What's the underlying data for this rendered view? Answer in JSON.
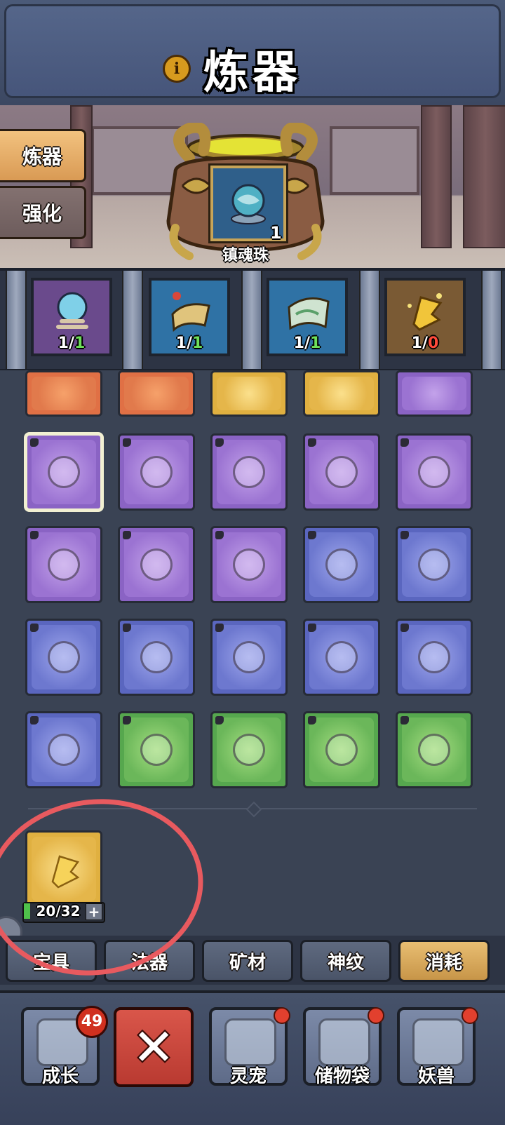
{
  "header": {
    "title": "炼器",
    "info_icon": "info-icon"
  },
  "side_tabs": [
    {
      "label": "炼器",
      "active": true
    },
    {
      "label": "强化",
      "active": false
    }
  ],
  "result": {
    "name": "镇魂珠",
    "count": "1",
    "icon": "soul-orb-icon"
  },
  "materials": [
    {
      "icon": "crystal-orb-icon",
      "have": "1/",
      "need": "1",
      "enough": true
    },
    {
      "icon": "scroll-icon",
      "have": "1/",
      "need": "1",
      "enough": true
    },
    {
      "icon": "map-scroll-icon",
      "have": "1/",
      "need": "1",
      "enough": true
    },
    {
      "icon": "golden-talisman-icon",
      "have": "1/",
      "need": "0",
      "enough": false
    }
  ],
  "grid": {
    "colors": {
      "purple": "#8a63c4",
      "blue": "#5a66bf",
      "green": "#56a74e",
      "orange": "#e07045",
      "yellow": "#e0b040"
    },
    "partial_row": [
      "orange",
      "orange",
      "yellow",
      "yellow",
      "purple"
    ],
    "rows": [
      [
        "purple",
        "purple",
        "purple",
        "purple",
        "purple"
      ],
      [
        "purple",
        "purple",
        "purple",
        "blue",
        "blue"
      ],
      [
        "blue",
        "blue",
        "blue",
        "blue",
        "blue"
      ],
      [
        "blue",
        "green",
        "green",
        "green",
        "green"
      ]
    ],
    "selected": "row0-col0"
  },
  "consumable": {
    "count": "20/32",
    "plus": "+",
    "color": "yellow",
    "fill_fraction": 0.08
  },
  "category_tabs": [
    {
      "label": "宝具",
      "active": false
    },
    {
      "label": "法器",
      "active": false
    },
    {
      "label": "矿材",
      "active": false
    },
    {
      "label": "神纹",
      "active": false
    },
    {
      "label": "消耗",
      "active": true
    }
  ],
  "bottom_nav": [
    {
      "label": "成长",
      "badge": "49",
      "icon": "growth-card-icon"
    },
    {
      "label": "",
      "icon": "close-icon",
      "close": "✕"
    },
    {
      "label": "灵宠",
      "icon": "spirit-pet-icon",
      "red_dot": true
    },
    {
      "label": "储物袋",
      "icon": "storage-bag-icon",
      "red_dot": true
    },
    {
      "label": "妖兽",
      "icon": "demon-beast-icon",
      "red_dot": true
    }
  ],
  "accent_colors": {
    "ok": "#6ee05a",
    "not_enough": "#ff4a3a",
    "annotation": "#e85a5f",
    "active_tab": "#e9be72"
  }
}
